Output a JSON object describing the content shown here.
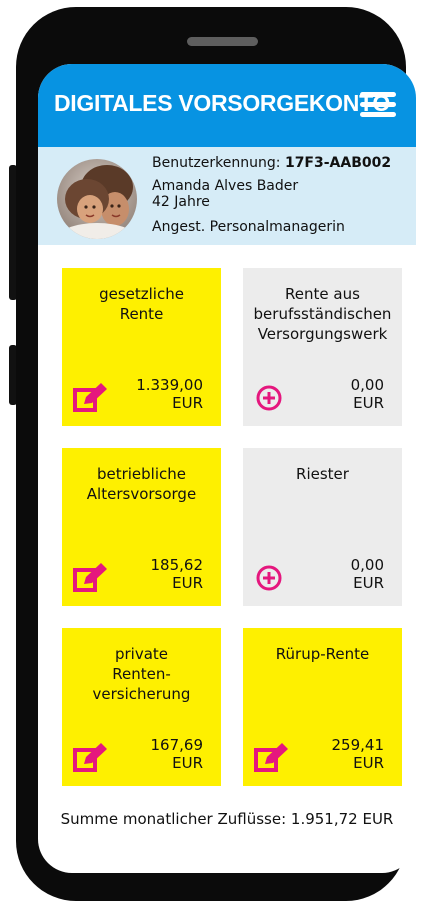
{
  "header": {
    "title": "DIGITALES VORSORGEKONTO"
  },
  "profile": {
    "id_label": "Benutzerkennung:",
    "id_value": "17F3-AAB002",
    "name": "Amanda Alves Bader",
    "age": "42 Jahre",
    "occupation": "Angest. Personalmanagerin"
  },
  "cards": [
    {
      "title": "gesetzliche Rente",
      "value": "1.339,00",
      "currency": "EUR",
      "icon": "edit-icon"
    },
    {
      "title": "Rente aus berufsständischen Versorgungswerk",
      "value": "0,00",
      "currency": "EUR",
      "icon": "plus-circle-icon"
    },
    {
      "title": "betriebliche Altersvorsorge",
      "value": "185,62",
      "currency": "EUR",
      "icon": "edit-icon"
    },
    {
      "title": "Riester",
      "value": "0,00",
      "currency": "EUR",
      "icon": "plus-circle-icon"
    },
    {
      "title": "private Renten-versicherung",
      "value": "167,69",
      "currency": "EUR",
      "icon": "edit-icon"
    },
    {
      "title": "Rürup-Rente",
      "value": "259,41",
      "currency": "EUR",
      "icon": "edit-icon"
    }
  ],
  "summary": "Summe monatlicher Zuflüsse: 1.951,72 EUR",
  "colors": {
    "brand_blue": "#0793e2",
    "profile_bg": "#d6ecf7",
    "card_yellow": "#fef000",
    "card_grey": "#ececec",
    "icon_magenta": "#e5177e"
  }
}
